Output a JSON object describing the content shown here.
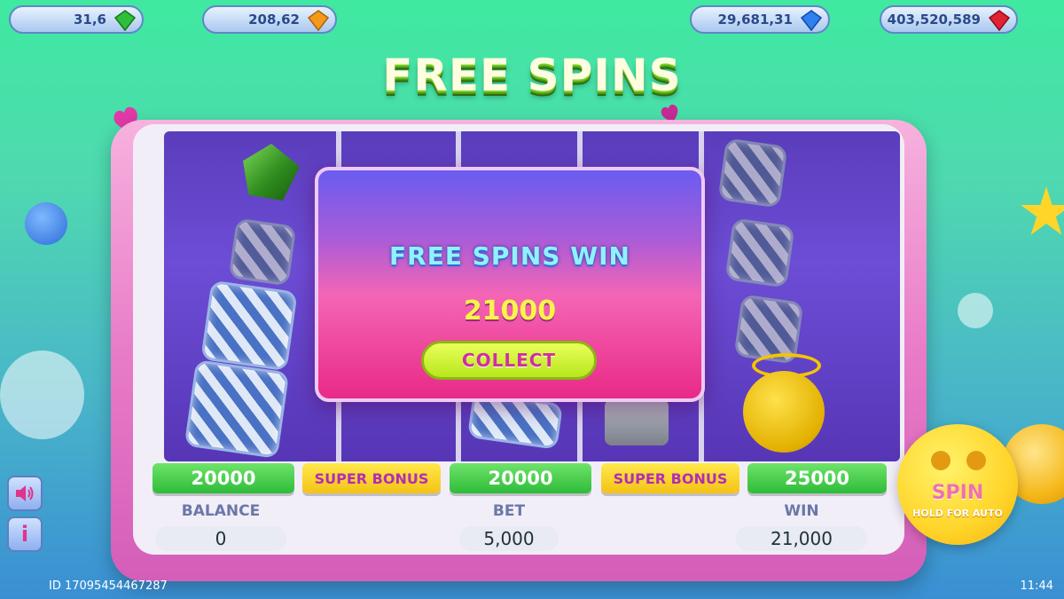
{
  "jackpots": [
    {
      "value": "31,6",
      "gem_icon": "green-gem-icon",
      "color": "#2fbf3a"
    },
    {
      "value": "208,62",
      "gem_icon": "orange-gem-icon",
      "color": "#f39a1a"
    },
    {
      "value": "29,681,31",
      "gem_icon": "blue-gem-icon",
      "color": "#2e7ff0"
    },
    {
      "value": "403,520,589",
      "gem_icon": "red-gem-icon",
      "color": "#e02232"
    }
  ],
  "title": "FREE SPINS",
  "popup": {
    "title": "FREE SPINS WIN",
    "amount": "21000",
    "collect_label": "COLLECT"
  },
  "reel_labels": [
    "20000",
    "SUPER BONUS",
    "20000",
    "SUPER BONUS",
    "25000"
  ],
  "stats": {
    "balance": {
      "label": "BALANCE",
      "value": "0"
    },
    "bet": {
      "label": "BET",
      "value": "5,000"
    },
    "win": {
      "label": "WIN",
      "value": "21,000"
    }
  },
  "spin": {
    "label": "SPIN",
    "sub": "HOLD FOR AUTO"
  },
  "footer": {
    "id": "ID 17095454467287",
    "time": "11:44"
  },
  "side_buttons": {
    "sound_icon": "speaker-icon",
    "info_label": "i"
  }
}
